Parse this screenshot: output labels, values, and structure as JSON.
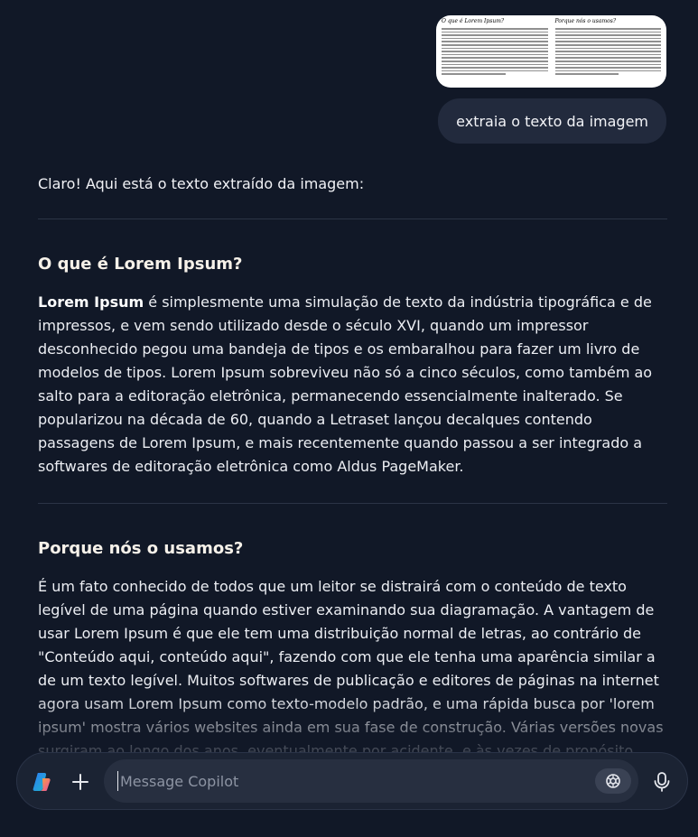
{
  "user_message": {
    "attachment": {
      "left_heading": "O que é Lorem Ipsum?",
      "right_heading": "Porque nós o usamos?",
      "left_bold": "Lorem Ipsum"
    },
    "text": "extraia o texto da imagem"
  },
  "response": {
    "intro": "Claro! Aqui está o texto extraído da imagem:",
    "section1": {
      "heading": "O que é Lorem Ipsum?",
      "bold_lead": "Lorem Ipsum",
      "body": " é simplesmente uma simulação de texto da indústria tipográfica e de impressos, e vem sendo utilizado desde o século XVI, quando um impressor desconhecido pegou uma bandeja de tipos e os embaralhou para fazer um livro de modelos de tipos. Lorem Ipsum sobreviveu não só a cinco séculos, como também ao salto para a editoração eletrônica, permanecendo essencialmente inalterado. Se popularizou na década de 60, quando a Letraset lançou decalques contendo passagens de Lorem Ipsum, e mais recentemente quando passou a ser integrado a softwares de editoração eletrônica como Aldus PageMaker."
    },
    "section2": {
      "heading": "Porque nós o usamos?",
      "body": "É um fato conhecido de todos que um leitor se distrairá com o conteúdo de texto legível de uma página quando estiver examinando sua diagramação. A vantagem de usar Lorem Ipsum é que ele tem uma distribuição normal de letras, ao contrário de \"Conteúdo aqui, conteúdo aqui\", fazendo com que ele tenha uma aparência similar a de um texto legível. Muitos softwares de publicação e editores de páginas na internet agora usam Lorem Ipsum como texto-modelo padrão, e uma rápida busca por 'lorem ipsum' mostra vários websites ainda em sua fase de construção. Várias versões novas surgiram ao longo dos anos, eventualmente por acidente, e às vezes de propósito (injetando humor, e coisas do"
    }
  },
  "composer": {
    "placeholder": "Message Copilot",
    "logo_icon": "copilot-logo-icon",
    "add_icon": "plus-icon",
    "camera_icon": "camera-icon",
    "mic_icon": "microphone-icon"
  },
  "colors": {
    "background": "#111827",
    "bubble": "#222a3d",
    "composer": "#1b2333",
    "input": "#272f40"
  }
}
